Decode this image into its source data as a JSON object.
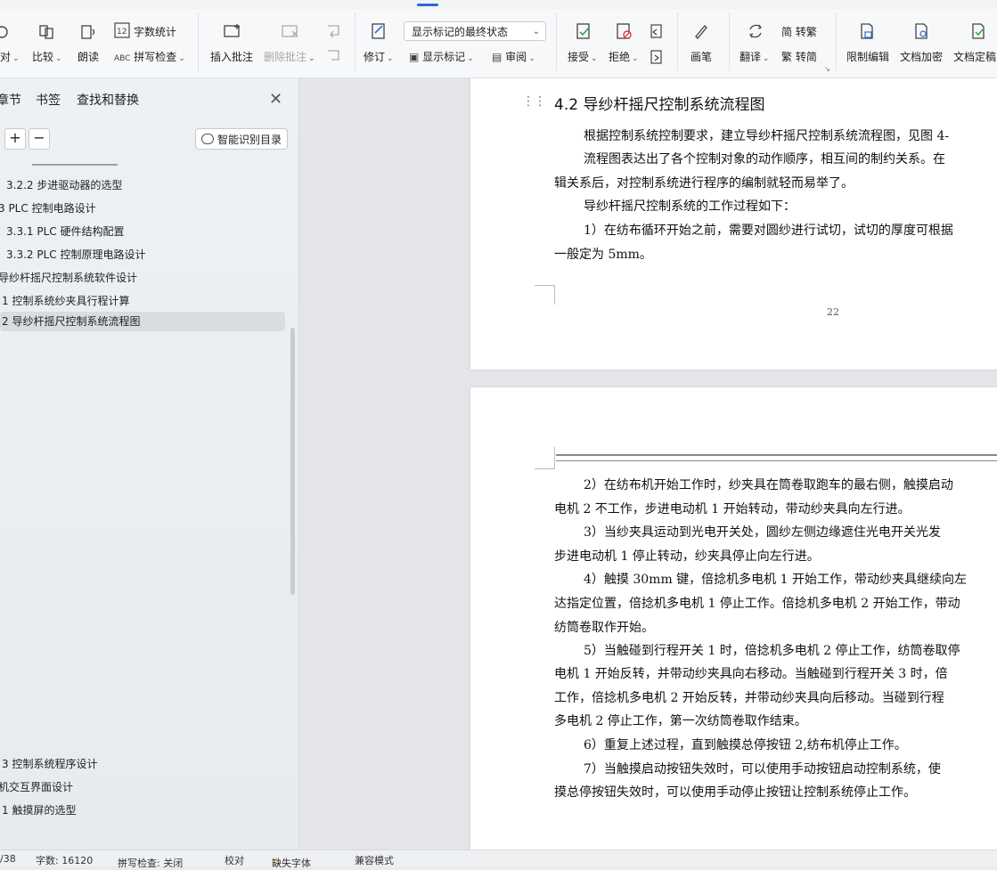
{
  "ribbon": {
    "row1": {
      "word_count": "字数统计",
      "display_select": "显示标记的最终状态"
    },
    "buttons": {
      "proofread": "对",
      "compare": "比较",
      "read_aloud": "朗读",
      "spell_check": "拼写检查",
      "insert_comment": "插入批注",
      "delete_comment": "删除批注",
      "revise": "修订",
      "show_markup": "显示标记",
      "review": "审阅",
      "accept": "接受",
      "reject": "拒绝",
      "pen": "画笔",
      "translate": "翻译",
      "to_traditional": "简 转繁",
      "to_simplified": "繁 转简",
      "restrict_edit": "限制编辑",
      "doc_encrypt": "文档加密",
      "doc_final": "文档定稿"
    }
  },
  "nav": {
    "tabs": [
      "章节",
      "书签",
      "查找和替换"
    ],
    "smart_toc": "智能识别目录",
    "toc_items": [
      "3.2.2  步进驱动器的选型",
      "3 PLC 控制电路设计",
      "3.3.1 PLC 硬件结构配置",
      "3.3.2 PLC 控制原理电路设计",
      "导纱杆摇尺控制系统软件设计",
      "1  控制系统纱夹具行程计算",
      "2 导纱杆摇尺控制系统流程图",
      "3  控制系统程序设计",
      "机交互界面设计",
      "1 触摸屏的选型"
    ]
  },
  "document": {
    "page1": {
      "heading": "4.2 导纱杆摇尺控制系统流程图",
      "lines": [
        "根据控制系统控制要求，建立导纱杆摇尺控制系统流程图，见图 4-",
        "流程图表达出了各个控制对象的动作顺序，相互间的制约关系。在",
        "辑关系后，对控制系统进行程序的编制就轻而易举了。",
        "导纱杆摇尺控制系统的工作过程如下：",
        "1）在纺布循环开始之前，需要对圆纱进行试切，试切的厚度可根据",
        "一般定为 5mm。"
      ],
      "page_number": "22"
    },
    "page2": {
      "lines": [
        "2）在纺布机开始工作时，纱夹具在筒卷取跑车的最右侧，触摸启动",
        "电机 2 不工作，步进电动机 1 开始转动，带动纱夹具向左行进。",
        "3）当纱夹具运动到光电开关处，圆纱左侧边缘遮住光电开关光发",
        "步进电动机 1 停止转动，纱夹具停止向左行进。",
        "4）触摸 30mm 键，倍捻机多电机 1 开始工作，带动纱夹具继续向左",
        "达指定位置，倍捻机多电机 1 停止工作。倍捻机多电机 2 开始工作，带动",
        "纺筒卷取作开始。",
        "5）当触碰到行程开关 1 时，倍捻机多电机 2 停止工作，纺筒卷取停",
        "电机 1 开始反转，并带动纱夹具向右移动。当触碰到行程开关 3 时，倍",
        "工作，倍捻机多电机 2 开始反转，并带动纱夹具向后移动。当碰到行程",
        "多电机 2 停止工作，第一次纺筒卷取作结束。",
        "6）重复上述过程，直到触摸总停按钮 2,纺布机停止工作。",
        "7）当触摸启动按钮失效时，可以使用手动按钮启动控制系统，使",
        "摸总停按钮失效时，可以使用手动停止按钮让控制系统停止工作。"
      ]
    }
  },
  "status": {
    "page": "/38",
    "words": "字数: 16120",
    "spell": "拼写检查: 关闭",
    "proof": "校对",
    "missing_font": "缺失字体",
    "compat": "兼容模式"
  }
}
